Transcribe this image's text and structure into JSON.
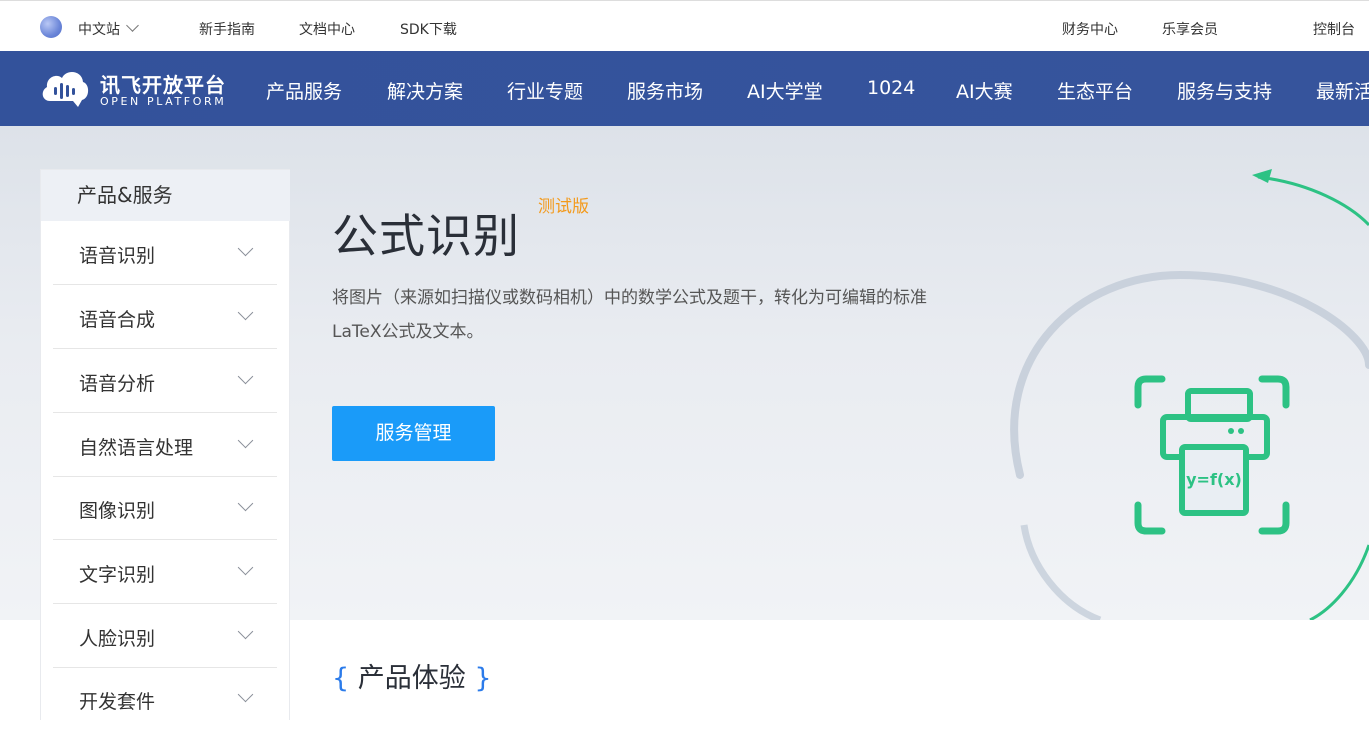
{
  "topbar": {
    "site": "中文站",
    "links": [
      "新手指南",
      "文档中心",
      "SDK下载"
    ],
    "right_links": [
      "财务中心",
      "乐享会员",
      "控制台"
    ]
  },
  "nav": {
    "logo_cn": "讯飞开放平台",
    "logo_en": "OPEN PLATFORM",
    "items": [
      "产品服务",
      "解决方案",
      "行业专题",
      "服务市场",
      "AI大学堂",
      "1024",
      "AI大赛",
      "生态平台",
      "服务与支持",
      "最新活"
    ]
  },
  "sidebar": {
    "title": "产品&服务",
    "items": [
      "语音识别",
      "语音合成",
      "语音分析",
      "自然语言处理",
      "图像识别",
      "文字识别",
      "人脸识别",
      "开发套件"
    ]
  },
  "hero": {
    "title": "公式识别",
    "badge": "测试版",
    "description_line1": "将图片（来源如扫描仪或数码相机）中的数学公式及题干，转化为可编辑的标准",
    "description_line2": "LaTeX公式及文本。",
    "button": "服务管理",
    "icon_formula": "y=f(x)"
  },
  "section": {
    "brace_left": "{",
    "title": "产品体验",
    "brace_right": "}"
  },
  "colors": {
    "nav_bg": "#33529b",
    "accent": "#1a9bf9",
    "badge": "#f39a1c",
    "icon_green": "#2dc284"
  }
}
